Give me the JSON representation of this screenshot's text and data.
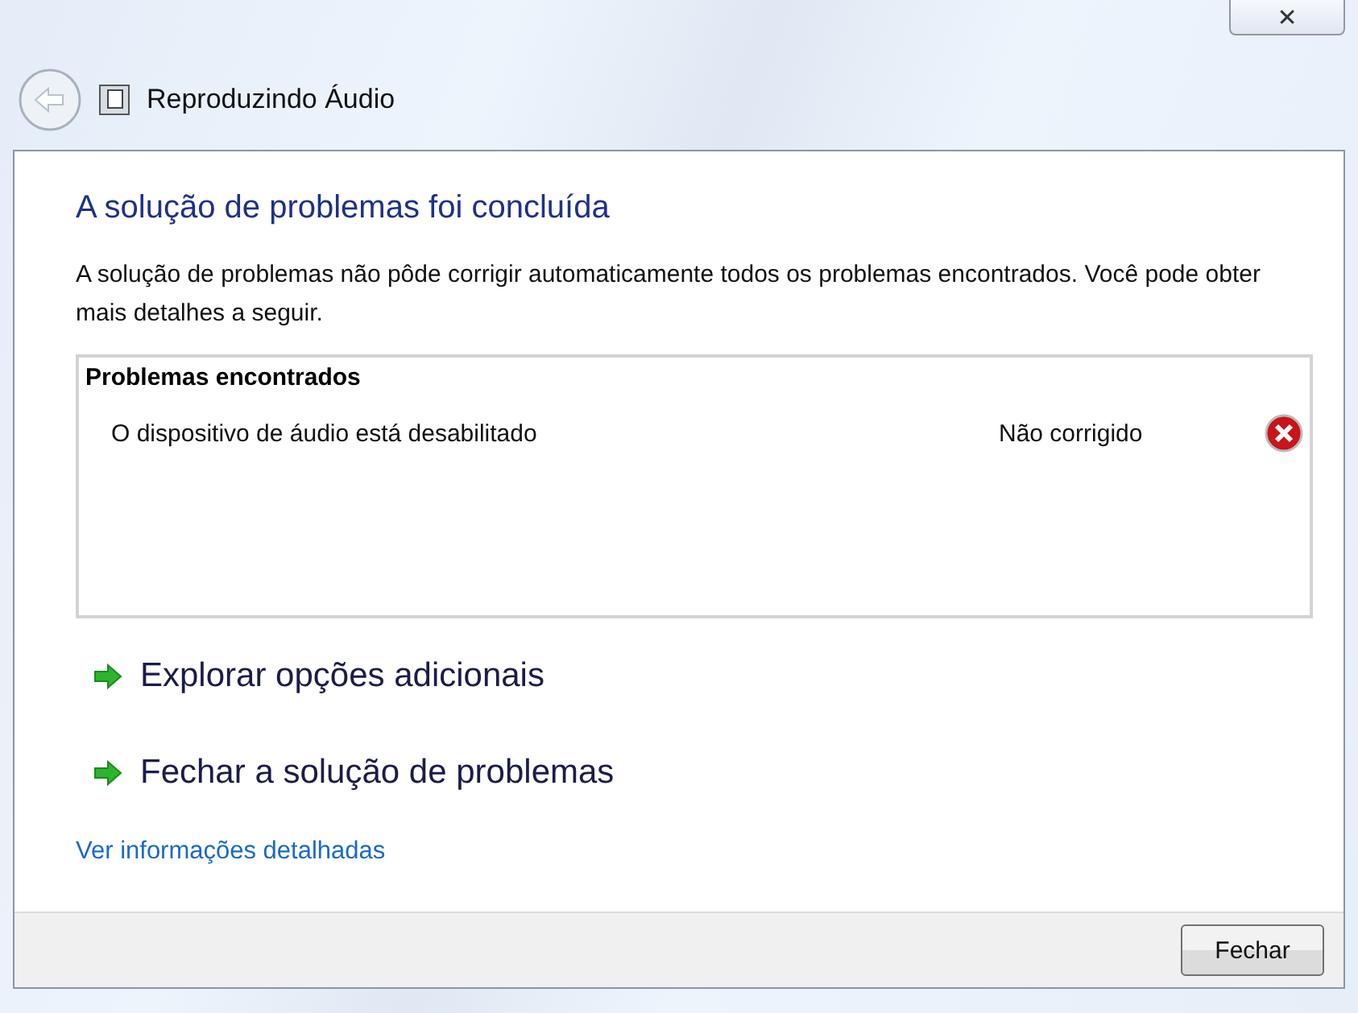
{
  "window": {
    "title": "Reproduzindo Áudio",
    "close_label": "✕"
  },
  "heading": "A solução de problemas foi concluída",
  "description": "A solução de problemas não pôde corrigir automaticamente todos os problemas encontrados. Você pode obter mais detalhes a seguir.",
  "problems": {
    "title": "Problemas encontrados",
    "items": [
      {
        "name": "O dispositivo de áudio está desabilitado",
        "status": "Não corrigido",
        "kind": "error"
      }
    ]
  },
  "options": [
    {
      "label": "Explorar opções adicionais"
    },
    {
      "label": "Fechar a solução de problemas"
    }
  ],
  "details_link": "Ver informações detalhadas",
  "buttons": [
    "Fechar"
  ]
}
